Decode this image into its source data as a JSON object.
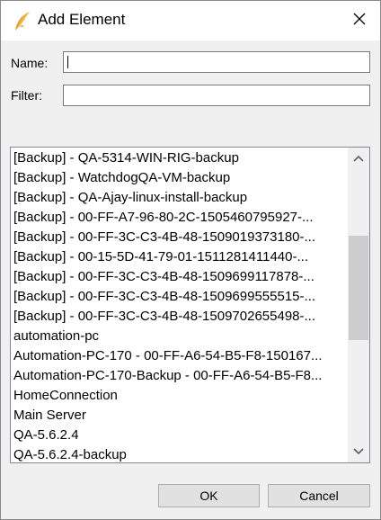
{
  "window": {
    "title": "Add Element",
    "app_icon": "feather-icon",
    "close_icon": "close-icon"
  },
  "form": {
    "name_label": "Name:",
    "name_value": "",
    "filter_label": "Filter:",
    "filter_value": ""
  },
  "list": {
    "items": [
      "[Backup]  - QA-5314-WIN-RIG-backup",
      "[Backup]  - WatchdogQA-VM-backup",
      "[Backup]  - QA-Ajay-linux-install-backup",
      "[Backup]  - 00-FF-A7-96-80-2C-1505460795927-...",
      "[Backup]  - 00-FF-3C-C3-4B-48-1509019373180-...",
      "[Backup]  - 00-15-5D-41-79-01-1511281411440-...",
      "[Backup]  - 00-FF-3C-C3-4B-48-1509699117878-...",
      "[Backup]  - 00-FF-3C-C3-4B-48-1509699555515-...",
      "[Backup]  - 00-FF-3C-C3-4B-48-1509702655498-...",
      "automation-pc",
      "Automation-PC-170 - 00-FF-A6-54-B5-F8-150167...",
      "Automation-PC-170-Backup - 00-FF-A6-54-B5-F8...",
      "HomeConnection",
      "Main Server",
      "QA-5.6.2.4",
      "QA-5.6.2.4-backup"
    ]
  },
  "buttons": {
    "ok": "OK",
    "cancel": "Cancel"
  },
  "colors": {
    "icon_gold": "#f2b233",
    "icon_gold_dark": "#e09a1c"
  }
}
